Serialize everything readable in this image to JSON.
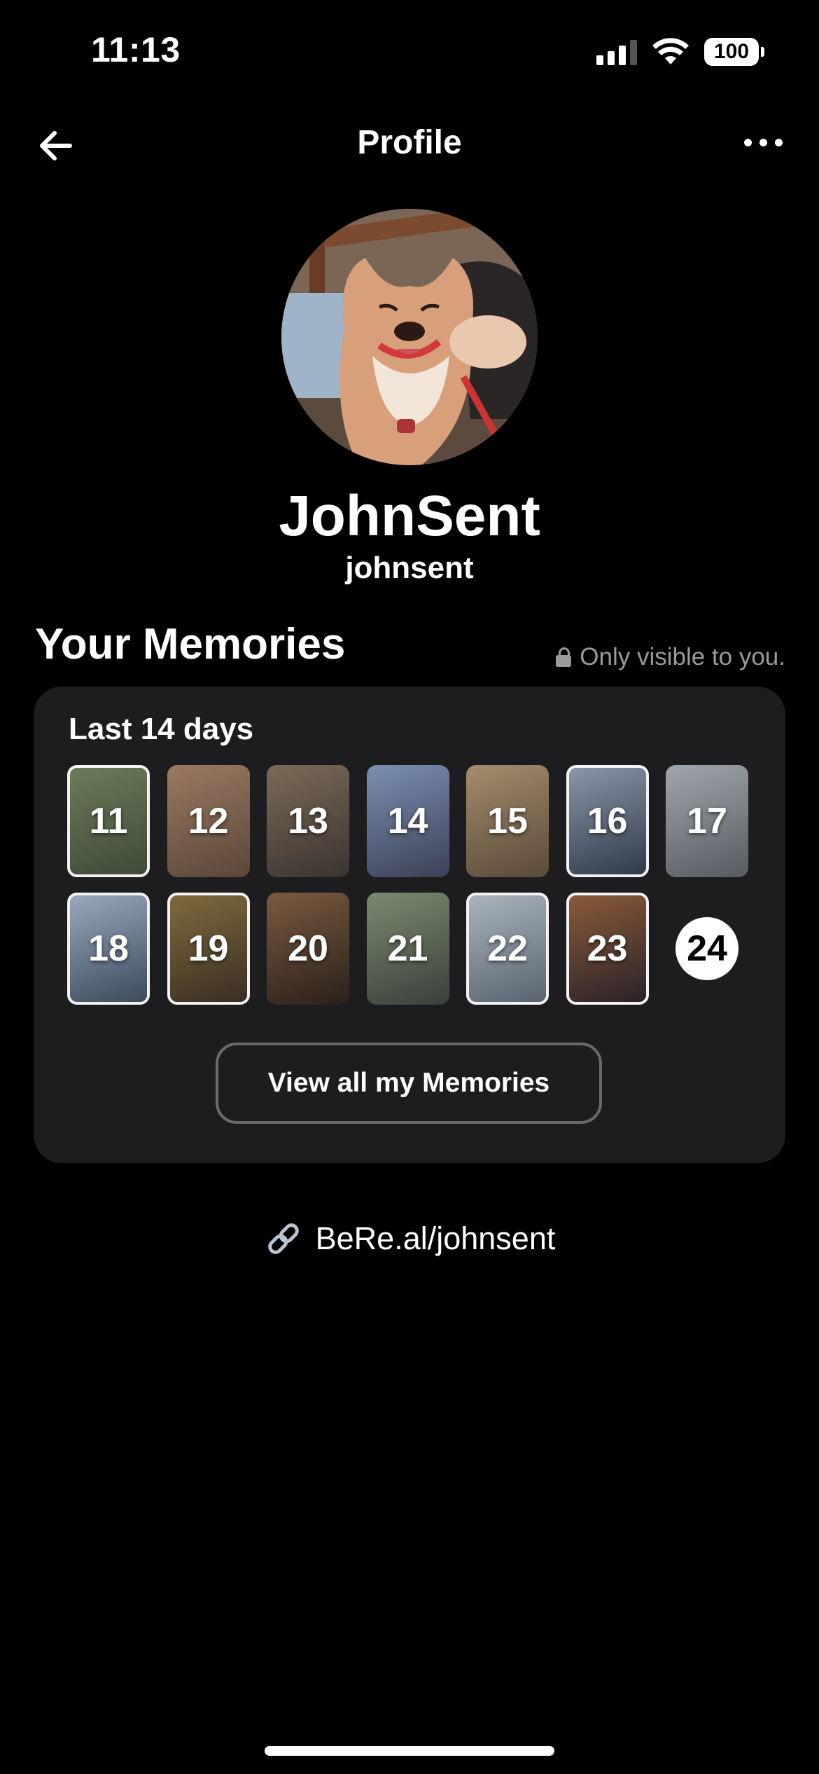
{
  "status_bar": {
    "time": "11:13",
    "battery": "100"
  },
  "nav": {
    "title": "Profile"
  },
  "profile": {
    "display_name": "JohnSent",
    "username": "johnsent"
  },
  "memories": {
    "title": "Your Memories",
    "privacy_note": "Only visible to you.",
    "period_label": "Last 14 days",
    "days": [
      {
        "day": "11",
        "bordered": true
      },
      {
        "day": "12",
        "bordered": false
      },
      {
        "day": "13",
        "bordered": false
      },
      {
        "day": "14",
        "bordered": false
      },
      {
        "day": "15",
        "bordered": false
      },
      {
        "day": "16",
        "bordered": true
      },
      {
        "day": "17",
        "bordered": false
      },
      {
        "day": "18",
        "bordered": true
      },
      {
        "day": "19",
        "bordered": true
      },
      {
        "day": "20",
        "bordered": false
      },
      {
        "day": "21",
        "bordered": false
      },
      {
        "day": "22",
        "bordered": true
      },
      {
        "day": "23",
        "bordered": true
      }
    ],
    "today": "24",
    "view_all_label": "View all my Memories"
  },
  "share_link": "BeRe.al/johnsent",
  "icons": [
    "back-arrow-icon",
    "more-icon",
    "lock-icon",
    "link-icon",
    "wifi-icon",
    "signal-icon",
    "battery-icon"
  ]
}
